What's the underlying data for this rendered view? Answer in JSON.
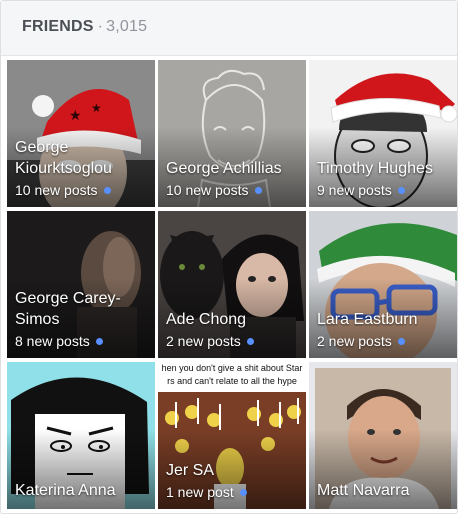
{
  "header": {
    "title": "FRIENDS",
    "separator": "·",
    "count": "3,015"
  },
  "accent_color": "#5890ff",
  "friends": [
    {
      "name": "George Kiourktsoglou",
      "posts": "10 new posts"
    },
    {
      "name": "George Achillias",
      "posts": "10 new posts"
    },
    {
      "name": "Timothy Hughes",
      "posts": "9 new posts"
    },
    {
      "name": "George Carey-Simos",
      "posts": "8 new posts"
    },
    {
      "name": "Ade Chong",
      "posts": "2 new posts"
    },
    {
      "name": "Lara Eastburn",
      "posts": "2 new posts"
    },
    {
      "name": "Katerina Anna",
      "posts": ""
    },
    {
      "name": "Jer SA",
      "posts": "1 new post",
      "photo_caption": "hen you don't give a shit about Star rs and can't relate to all the hype"
    },
    {
      "name": "Matt Navarra",
      "posts": ""
    }
  ]
}
